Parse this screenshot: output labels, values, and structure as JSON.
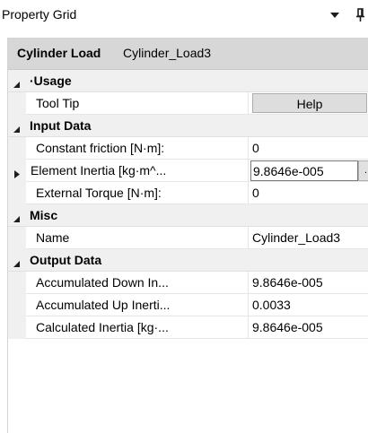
{
  "panel": {
    "title": "Property Grid",
    "dropdown_icon": "triangle-down-icon",
    "pin_icon": "pin-icon"
  },
  "header": {
    "object_type": "Cylinder Load",
    "object_name": "Cylinder_Load3"
  },
  "categories": {
    "usage": {
      "label": "·Usage",
      "expanded": true,
      "properties": {
        "tool_tip": {
          "name": "Tool Tip",
          "button_label": "Help"
        }
      }
    },
    "input_data": {
      "label": "Input Data",
      "expanded": true,
      "properties": {
        "constant_friction": {
          "name": "Constant friction [N·m]:",
          "value": "0"
        },
        "element_inertia": {
          "name": "Element Inertia [kg·m^...",
          "value": "9.8646e-005",
          "ellipsis_label": "...",
          "collapsed": true
        },
        "external_torque": {
          "name": "External Torque [N·m]:",
          "value": "0"
        }
      }
    },
    "misc": {
      "label": "Misc",
      "expanded": true,
      "properties": {
        "name": {
          "name": "Name",
          "value": "Cylinder_Load3"
        }
      }
    },
    "output_data": {
      "label": "Output Data",
      "expanded": true,
      "properties": {
        "accumulated_down": {
          "name": "Accumulated Down In...",
          "value": "9.8646e-005"
        },
        "accumulated_up": {
          "name": "Accumulated Up Inerti...",
          "value": "0.0033"
        },
        "calculated_inertia": {
          "name": "Calculated Inertia [kg·...",
          "value": "9.8646e-005"
        }
      }
    }
  },
  "colors": {
    "header_bg": "#d7d7d7",
    "category_bg": "#f0f0f0",
    "button_bg": "#dddddd",
    "grid_line": "#e6e6e6"
  }
}
